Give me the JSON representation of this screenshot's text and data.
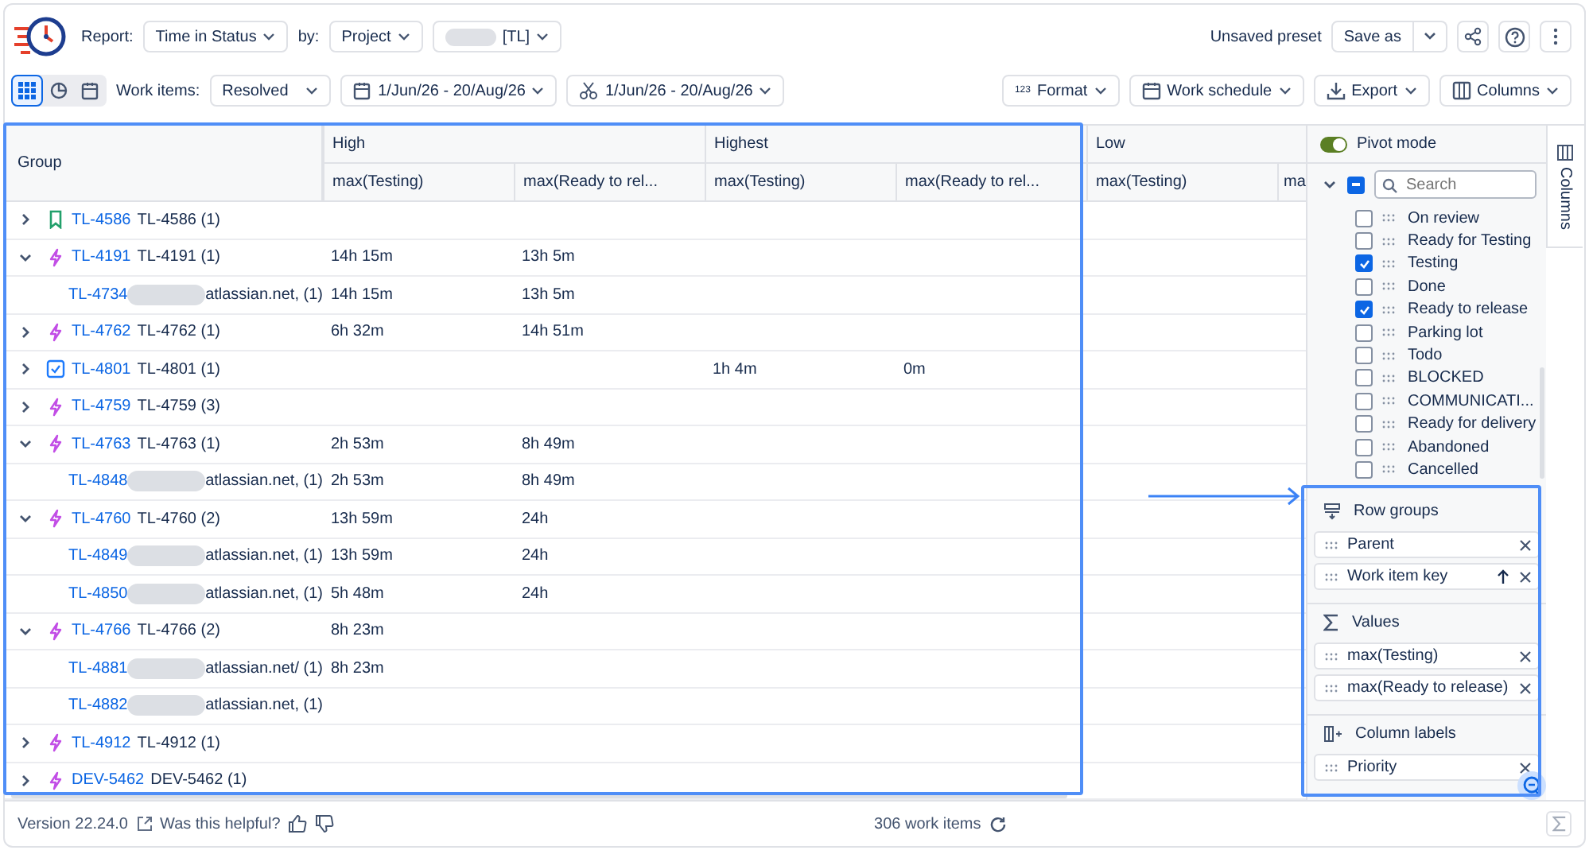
{
  "header": {
    "report_label": "Report:",
    "report": "Time in Status",
    "by_label": "by:",
    "by": "Project",
    "project": "[TL]",
    "project_redacted": true,
    "preset": "Unsaved preset",
    "save": "Save as"
  },
  "toolbar": {
    "views": [
      {
        "kind": "grid",
        "selected": true
      },
      {
        "kind": "chart",
        "selected": false
      },
      {
        "kind": "calendar",
        "selected": false
      }
    ],
    "work_items_label": "Work items:",
    "work_items": "Resolved",
    "date_range": "1/Jun/26 - 20/Aug/26",
    "cut_range": "1/Jun/26 - 20/Aug/26",
    "format_badge": "123",
    "format": "Format",
    "schedule": "Work schedule",
    "export": "Export",
    "columns": "Columns"
  },
  "table": {
    "group_header": "Group",
    "column_groups": [
      {
        "label": "High",
        "columns": [
          "max(Testing)",
          "max(Ready to rel..."
        ]
      },
      {
        "label": "Highest",
        "columns": [
          "max(Testing)",
          "max(Ready to rel..."
        ]
      },
      {
        "label": "Low",
        "columns": [
          "max(Testing)",
          "ma"
        ]
      }
    ],
    "rows": [
      {
        "kind": "story",
        "expanded": false,
        "key": "TL-4586",
        "label": "TL-4586 (1)"
      },
      {
        "kind": "epic",
        "expanded": true,
        "key": "TL-4191",
        "label": "TL-4191 (1)",
        "high_testing": "14h 15m",
        "high_ready": "13h 5m"
      },
      {
        "kind": "child",
        "key": "TL-4734",
        "redacted": true,
        "label": "atlassian.net, (1)",
        "high_testing": "14h 15m",
        "high_ready": "13h 5m"
      },
      {
        "kind": "epic",
        "expanded": false,
        "key": "TL-4762",
        "label": "TL-4762 (1)",
        "high_testing": "6h 32m",
        "high_ready": "14h 51m"
      },
      {
        "kind": "task",
        "expanded": false,
        "key": "TL-4801",
        "label": "TL-4801 (1)",
        "highest_testing": "1h 4m",
        "highest_ready": "0m"
      },
      {
        "kind": "epic",
        "expanded": false,
        "key": "TL-4759",
        "label": "TL-4759 (3)"
      },
      {
        "kind": "epic",
        "expanded": true,
        "key": "TL-4763",
        "label": "TL-4763 (1)",
        "high_testing": "2h 53m",
        "high_ready": "8h 49m"
      },
      {
        "kind": "child",
        "key": "TL-4848",
        "redacted": true,
        "label": "atlassian.net, (1)",
        "high_testing": "2h 53m",
        "high_ready": "8h 49m"
      },
      {
        "kind": "epic",
        "expanded": true,
        "key": "TL-4760",
        "label": "TL-4760 (2)",
        "high_testing": "13h 59m",
        "high_ready": "24h"
      },
      {
        "kind": "child",
        "key": "TL-4849",
        "redacted": true,
        "label": "atlassian.net, (1)",
        "high_testing": "13h 59m",
        "high_ready": "24h"
      },
      {
        "kind": "child",
        "key": "TL-4850",
        "redacted": true,
        "label": "atlassian.net, (1)",
        "high_testing": "5h 48m",
        "high_ready": "24h"
      },
      {
        "kind": "epic",
        "expanded": true,
        "key": "TL-4766",
        "label": "TL-4766 (2)",
        "high_testing": "8h 23m"
      },
      {
        "kind": "child",
        "key": "TL-4881",
        "redacted": true,
        "label": "atlassian.net/ (1)",
        "high_testing": "8h 23m"
      },
      {
        "kind": "child",
        "key": "TL-4882",
        "redacted": true,
        "label": "atlassian.net, (1)"
      },
      {
        "kind": "epic",
        "expanded": false,
        "key": "TL-4912",
        "label": "TL-4912 (1)"
      },
      {
        "kind": "epic",
        "expanded": false,
        "key": "DEV-5462",
        "label": "DEV-5462 (1)"
      }
    ]
  },
  "panel": {
    "pivot_label": "Pivot mode",
    "pivot_on": true,
    "select_all_partial": true,
    "search": {
      "placeholder": "Search"
    },
    "fields": [
      {
        "label": "On review",
        "checked": false
      },
      {
        "label": "Ready for Testing",
        "checked": false
      },
      {
        "label": "Testing",
        "checked": true
      },
      {
        "label": "Done",
        "checked": false
      },
      {
        "label": "Ready to release",
        "checked": true
      },
      {
        "label": "Parking lot",
        "checked": false
      },
      {
        "label": "Todo",
        "checked": false
      },
      {
        "label": "BLOCKED",
        "checked": false
      },
      {
        "label": "COMMUNICATI...",
        "checked": false
      },
      {
        "label": "Ready for delivery",
        "checked": false
      },
      {
        "label": "Abandoned",
        "checked": false
      },
      {
        "label": "Cancelled",
        "checked": false
      }
    ],
    "sections": [
      {
        "kind": "rows",
        "title": "Row groups",
        "chips": [
          {
            "label": "Parent",
            "sortable": false
          },
          {
            "label": "Work item key",
            "sortable": true
          }
        ]
      },
      {
        "kind": "values",
        "title": "Values",
        "chips": [
          {
            "label": "max(Testing)",
            "sortable": false
          },
          {
            "label": "max(Ready to release)",
            "sortable": false
          }
        ]
      },
      {
        "kind": "columns",
        "title": "Column labels",
        "chips": [
          {
            "label": "Priority",
            "sortable": false
          }
        ]
      }
    ],
    "side_tab": "Columns"
  },
  "footer": {
    "version": "Version 22.24.0",
    "helpful": "Was this helpful?",
    "count": "306 work items"
  },
  "callouts": [
    {
      "kind": "frame"
    },
    {
      "kind": "frame"
    },
    {
      "kind": "arrow"
    }
  ]
}
